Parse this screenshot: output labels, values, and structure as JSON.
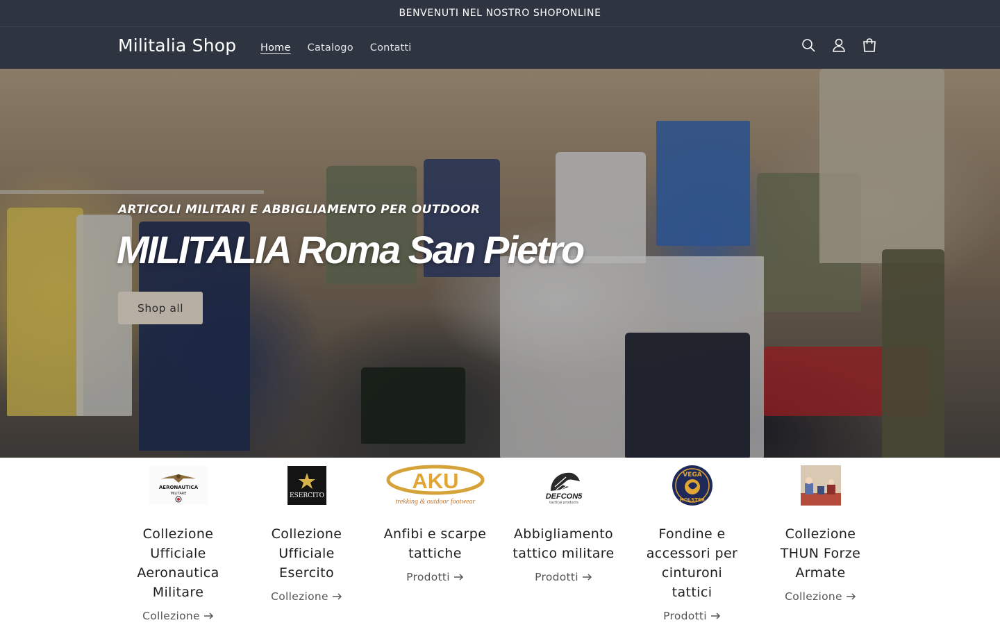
{
  "announcement": {
    "text": "BENVENUTI NEL NOSTRO SHOPONLINE"
  },
  "header": {
    "logo": "Militalia Shop",
    "nav": [
      {
        "label": "Home",
        "active": true
      },
      {
        "label": "Catalogo",
        "active": false
      },
      {
        "label": "Contatti",
        "active": false
      }
    ],
    "icons": [
      "search-icon",
      "account-icon",
      "cart-icon"
    ]
  },
  "hero": {
    "subtitle": "ARTICOLI MILITARI E ABBIGLIAMENTO PER OUTDOOR",
    "title": "MILITALIA Roma San Pietro",
    "button": "Shop all"
  },
  "collections": [
    {
      "title": "Collezione Ufficiale Aeronautica Militare",
      "link": "Collezione",
      "logo_text": "AERONAUTICA MILITARE"
    },
    {
      "title": "Collezione Ufficiale Esercito",
      "link": "Collezione",
      "logo_text": "ESERCITO"
    },
    {
      "title": "Anfibi e scarpe tattiche",
      "link": "Prodotti",
      "logo_text": "AKU",
      "logo_subtext": "trekking & outdoor footwear"
    },
    {
      "title": "Abbigliamento tattico militare",
      "link": "Prodotti",
      "logo_text": "DEFCON5",
      "logo_subtext": "tactical products"
    },
    {
      "title": "Fondine e accessori per cinturoni tattici",
      "link": "Prodotti",
      "logo_text": "VEGA HOLSTER"
    },
    {
      "title": "Collezione THUN Forze Armate",
      "link": "Collezione",
      "logo_text": ""
    }
  ],
  "colors": {
    "header_bg": "#2f3540",
    "button_bg": "#b7aea4",
    "text": "#1d1d1d"
  }
}
